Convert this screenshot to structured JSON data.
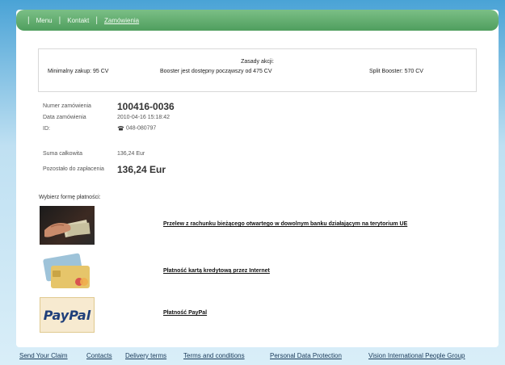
{
  "nav": {
    "items": [
      {
        "label": "Menu"
      },
      {
        "label": "Kontakt"
      },
      {
        "label": "Zamówienia"
      }
    ]
  },
  "rules": {
    "title": "Zasady akcji:",
    "min_purchase": "Minimalny zakup: 95 CV",
    "booster": "Booster jest dostępny począwszy od 475 CV",
    "split_booster": "Split Booster: 570 CV"
  },
  "order": {
    "number_label": "Numer zamówienia",
    "number_value": "100416-0036",
    "date_label": "Data zamówienia",
    "date_value": "2010-04-16 15:18:42",
    "id_label": "ID:",
    "id_value": "048-080797",
    "total_label": "Suma całkowita",
    "total_value": "136,24 Eur",
    "remaining_label": "Pozostało do zapłacenia",
    "remaining_value": "136,24 Eur"
  },
  "payment": {
    "heading": "Wybierz formę płatności:",
    "options": [
      {
        "label": "Przelew z rachunku bieżącego otwartego w dowolnym banku działającym na terytorium UE",
        "icon": "bank-transfer-photo"
      },
      {
        "label": "Płatność kartą kredytową przez Internet",
        "icon": "credit-cards-image"
      },
      {
        "label": "Płatność PayPal",
        "icon": "paypal-logo",
        "logo_text": "PayPal"
      }
    ]
  },
  "footer": {
    "links": [
      {
        "label": "Send Your Claim"
      },
      {
        "label": "Contacts"
      },
      {
        "label": "Delivery terms"
      },
      {
        "label": "Terms and conditions"
      },
      {
        "label": "Personal Data Protection"
      },
      {
        "label": "Vision International People Group"
      }
    ]
  }
}
